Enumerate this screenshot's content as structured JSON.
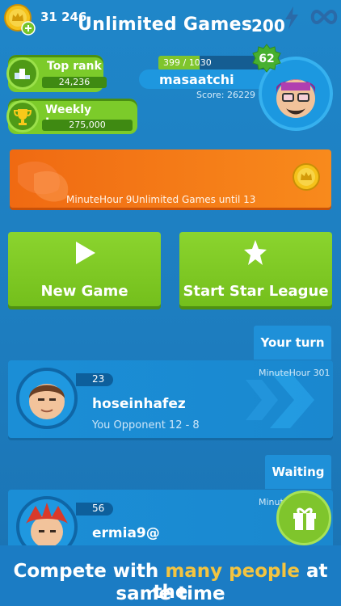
{
  "topbar": {
    "coins": "31 246"
  },
  "ranks": {
    "top_rank_label": "Top rank",
    "top_rank_value": "24,236",
    "weekly_label": "Weekly League",
    "weekly_value": "275,000"
  },
  "profile": {
    "xp_text": "399 / 1030",
    "xp_fraction": 0.387,
    "level": "62",
    "username": "masaatchi",
    "score": "Score: 26229"
  },
  "banner": {
    "title": "Unlimited Games",
    "price": "200",
    "subtitle": "MinuteHour 9Unlimited Games until 13"
  },
  "buttons": {
    "new_game": "New Game",
    "star_league": "Start Star League"
  },
  "games": {
    "your_turn_label": "Your turn",
    "game1": {
      "level": "23",
      "name": "hoseinhafez",
      "score": "You Opponent 12 - 8",
      "tag": "MinuteHour 301"
    },
    "waiting_label": "Waiting",
    "game2": {
      "level": "56",
      "name": "ermia9@",
      "tag": "Minute"
    }
  },
  "caption": {
    "pre": "Compete with ",
    "highlight": "many people",
    "post": " at the",
    "line2": "same time"
  },
  "colors": {
    "bg": "#1f86c9",
    "green": "#7ccb2a",
    "orange": "#f06a12",
    "gold": "#f3c440"
  }
}
